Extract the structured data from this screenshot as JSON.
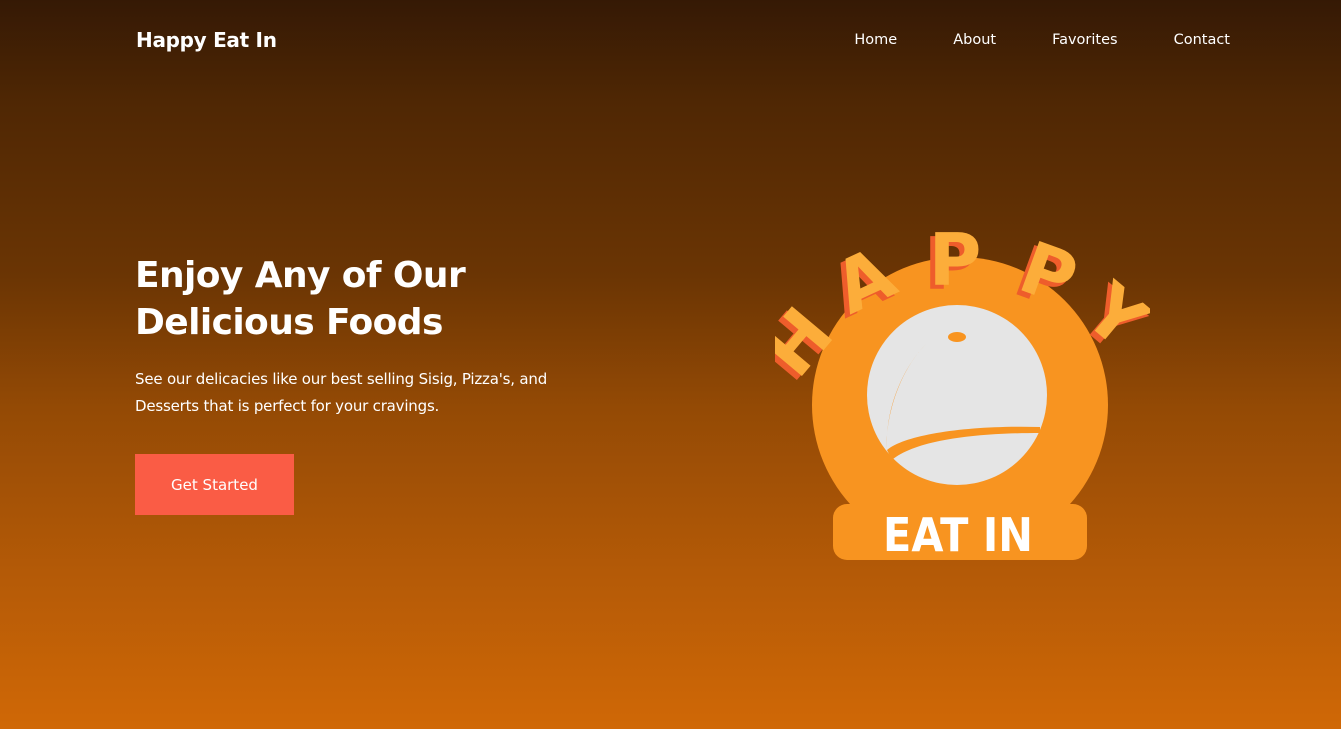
{
  "nav": {
    "brand": "Happy Eat In",
    "links": [
      {
        "label": "Home"
      },
      {
        "label": "About"
      },
      {
        "label": "Favorites"
      },
      {
        "label": "Contact"
      }
    ]
  },
  "hero": {
    "title_line1": "Enjoy Any of Our",
    "title_line2": "Delicious Foods",
    "description": "See our delicacies like our best selling Sisig, Pizza's, and Desserts that is perfect for your cravings.",
    "cta_label": "Get Started"
  },
  "logo": {
    "top_word": "HAPPY",
    "bottom_word": "EAT IN",
    "icon": "food-cloche-icon"
  },
  "colors": {
    "gradient_top": "#351905",
    "gradient_bottom": "#d06806",
    "cta_background": "#fa5c45",
    "logo_orange": "#f89420",
    "logo_letter": "#fcad3a",
    "logo_shadow": "#ee5d2b",
    "cloche_gray": "#e5e5e5"
  }
}
